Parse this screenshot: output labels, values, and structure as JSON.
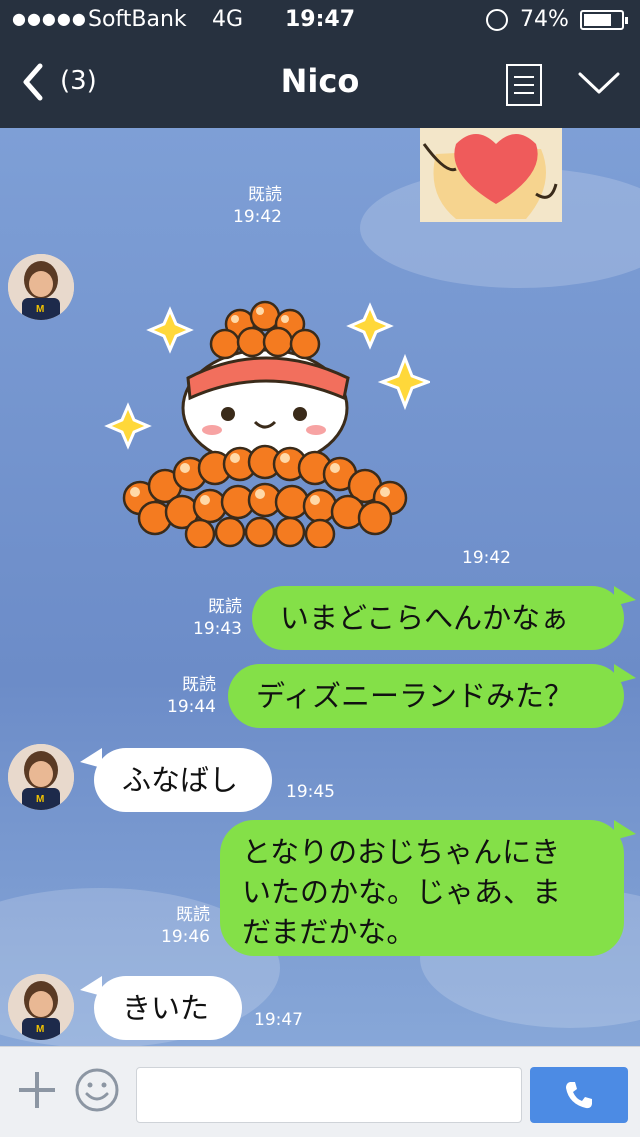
{
  "status_bar": {
    "signal": "●●●●●",
    "carrier": "SoftBank",
    "network": "4G",
    "time": "19:47",
    "battery_percent": "74%",
    "battery_level": 0.74
  },
  "header": {
    "back_count": "(3)",
    "title": "Nico"
  },
  "messages": [
    {
      "side": "out",
      "type": "sticker",
      "read": "既読",
      "time": "19:42"
    },
    {
      "side": "in",
      "type": "sticker",
      "time": "19:42"
    },
    {
      "side": "out",
      "type": "text",
      "text": "いまどこらへんかなぁ",
      "read": "既読",
      "time": "19:43"
    },
    {
      "side": "out",
      "type": "text",
      "text": "ディズニーランドみた？",
      "read": "既読",
      "time": "19:44"
    },
    {
      "side": "in",
      "type": "text",
      "text": "ふなばし",
      "time": "19:45"
    },
    {
      "side": "out",
      "type": "text",
      "lines": [
        "となりのおじちゃんにき",
        "いたのかな。じゃあ、ま",
        "だまだかな。"
      ],
      "read": "既読",
      "time": "19:46"
    },
    {
      "side": "in",
      "type": "text",
      "text": "きいた",
      "time": "19:47"
    }
  ],
  "input": {
    "placeholder": ""
  },
  "colors": {
    "header_bg": "#27313f",
    "chat_bg": "#6f8fc8",
    "outgoing_bubble": "#84e048",
    "incoming_bubble": "#ffffff",
    "call_button": "#4c8be4"
  },
  "icons": {
    "back": "chevron-left-icon",
    "notes": "notes-icon",
    "menu": "chevron-down-icon",
    "plus": "plus-icon",
    "emoji": "emoji-icon",
    "call": "phone-icon"
  }
}
